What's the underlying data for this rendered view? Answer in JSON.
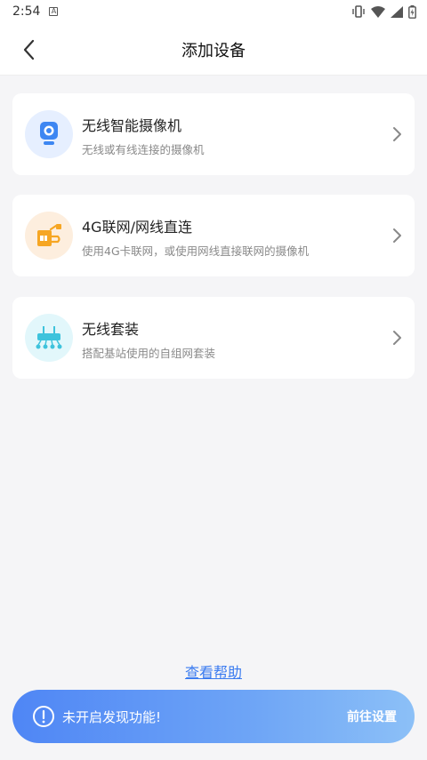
{
  "status_bar": {
    "time": "2:54"
  },
  "nav": {
    "title": "添加设备"
  },
  "cards": [
    {
      "title": "无线智能摄像机",
      "desc": "无线或有线连接的摄像机",
      "icon": "camera-icon",
      "icon_bg": "#e6efff"
    },
    {
      "title": "4G联网/网线直连",
      "desc": "使用4G卡联网，或使用网线直接联网的摄像机",
      "icon": "sim-card-icon",
      "icon_bg": "#fdeede"
    },
    {
      "title": "无线套装",
      "desc": "搭配基站使用的自组网套装",
      "icon": "router-icon",
      "icon_bg": "#e2f7fb"
    }
  ],
  "help_link": "查看帮助",
  "banner": {
    "message": "未开启发现功能!",
    "action": "前往设置",
    "colors": {
      "start": "#4f86f5",
      "end": "#8cc0f7"
    }
  },
  "colors": {
    "accent": "#3a7bf0",
    "camera": "#3d86f2",
    "sim": "#f6a623",
    "router": "#3ec3dc"
  }
}
